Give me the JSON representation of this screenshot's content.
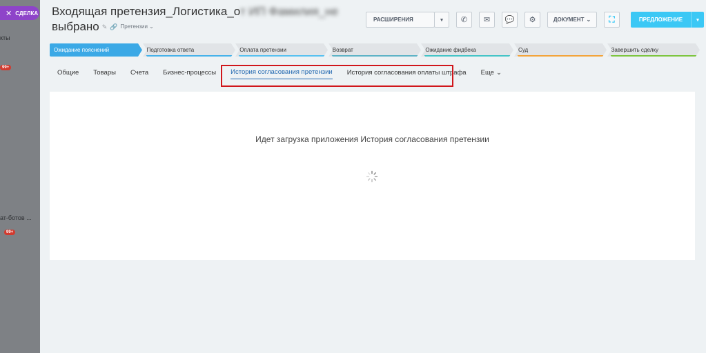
{
  "sidebar": {
    "close_label": "СДЕЛКА",
    "text_1": "кты",
    "badge_1": "99+",
    "text_2": "ат-ботов ...",
    "badge_2": "99+"
  },
  "deal": {
    "title_start": "Входящая претензия_Логистика_о",
    "title_blurred": "т ИП Фамилия_не",
    "title_line2": "выбрано",
    "category": "Претензии"
  },
  "toolbar": {
    "extensions_label": "РАСШИРЕНИЯ",
    "document_label": "ДОКУМЕНТ",
    "primary_label": "ПРЕДЛОЖЕНИЕ"
  },
  "stages": [
    {
      "label": "Ожидание пояснений",
      "color": "#3ba9e6",
      "active": true
    },
    {
      "label": "Подготовка ответа",
      "color": "#47b2ea",
      "active": false
    },
    {
      "label": "Оплата претензии",
      "color": "#58c1f0",
      "active": false
    },
    {
      "label": "Возврат",
      "color": "#5eb3c6",
      "active": false
    },
    {
      "label": "Ожидание фидбека",
      "color": "#45c4c7",
      "active": false
    },
    {
      "label": "Суд",
      "color": "#f3a43a",
      "active": false
    },
    {
      "label": "Завершить сделку",
      "color": "#7dc53f",
      "active": false
    }
  ],
  "tabs": [
    {
      "label": "Общие"
    },
    {
      "label": "Товары"
    },
    {
      "label": "Счета"
    },
    {
      "label": "Бизнес-процессы"
    },
    {
      "label": "История согласования претензии"
    },
    {
      "label": "История согласования оплаты штрафа"
    }
  ],
  "tab_more": "Еще",
  "content": {
    "loading_message": "Идет загрузка приложения История согласования претензии"
  },
  "colors": {
    "accent": "#3bc8f5",
    "active_tab": "#2067b0",
    "highlight": "#d0161b"
  }
}
